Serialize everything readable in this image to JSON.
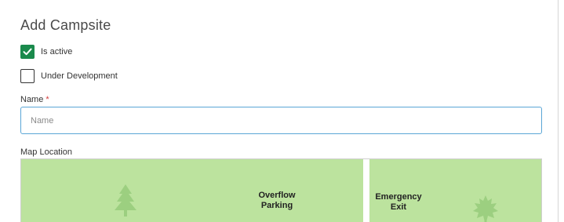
{
  "dialog": {
    "title": "Add Campsite"
  },
  "options": {
    "is_active_label": "Is active",
    "is_active_checked": true,
    "under_development_label": "Under Development",
    "under_development_checked": false
  },
  "name_field": {
    "label": "Name",
    "required_marker": "*",
    "value": "",
    "placeholder": "Name"
  },
  "map": {
    "label": "Map Location",
    "background_color": "#bce39e",
    "areas": [
      {
        "label": "Overflow\nParking"
      },
      {
        "label": "Emergency\nExit"
      }
    ],
    "icons": [
      "pine-tree-icon",
      "maple-tree-icon"
    ]
  },
  "colors": {
    "accent_check": "#1a8a4c",
    "input_focus_border": "#5aa6d6",
    "required": "#d43c3c"
  }
}
